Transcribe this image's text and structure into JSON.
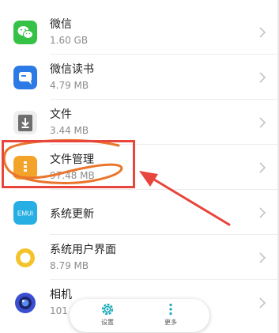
{
  "apps": [
    {
      "name": "微信",
      "size": "1.60 GB",
      "icon": "wechat-icon"
    },
    {
      "name": "微信读书",
      "size": "4.79 MB",
      "icon": "weread-icon"
    },
    {
      "name": "文件",
      "size": "3.44 MB",
      "icon": "files-download-icon"
    },
    {
      "name": "文件管理",
      "size": "97.48 MB",
      "icon": "file-manager-icon"
    },
    {
      "name": "系统更新",
      "size": "",
      "icon": "emui-update-icon",
      "icon_text": "EMUI"
    },
    {
      "name": "系统用户界面",
      "size": "8.79 MB",
      "icon": "system-ui-icon"
    },
    {
      "name": "相机",
      "size": "101",
      "icon": "camera-icon"
    }
  ],
  "bottom_bar": {
    "settings_label": "设置",
    "more_label": "更多"
  },
  "colors": {
    "wechat_green": "#35c247",
    "weread_blue": "#2b7ae6",
    "files_gray": "#6e6e6e",
    "file_manager_orange": "#f3a32a",
    "emui_blue": "#27aee3",
    "system_ui_yellow": "#f4c22b",
    "camera_blue": "#3a4fd0",
    "settings_teal": "#1aa9b8",
    "annotation_red": "#e8453c",
    "annotation_orange": "#e9762c"
  }
}
